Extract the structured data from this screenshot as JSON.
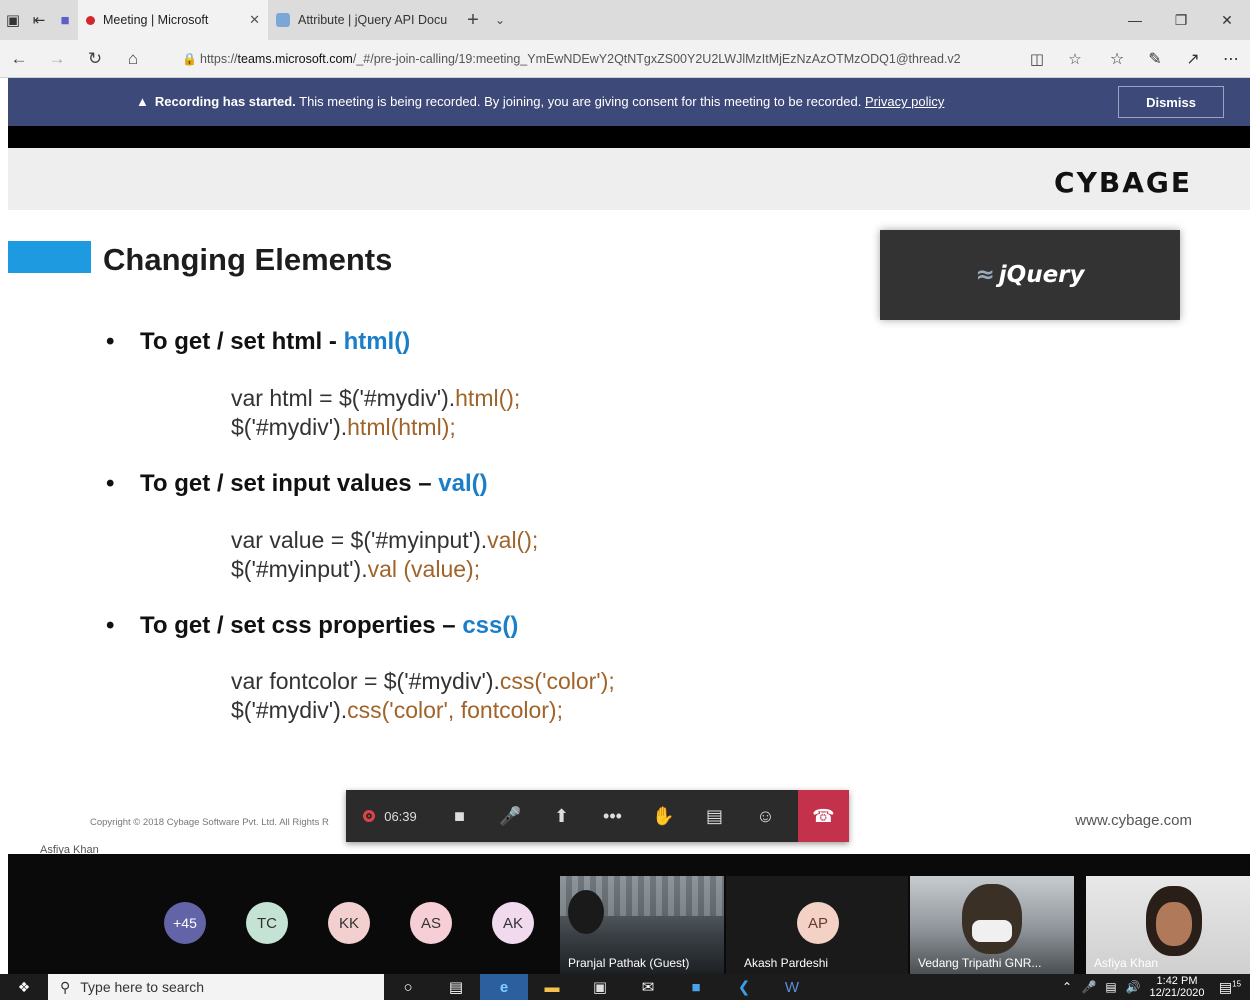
{
  "browser": {
    "tabs": [
      {
        "title": "Meeting | Microsoft",
        "active": true,
        "recording": true
      },
      {
        "title": "Attribute | jQuery API Docu",
        "active": false
      }
    ],
    "url": {
      "scheme": "https://",
      "host": "teams.microsoft.com",
      "path": "/_#/pre-join-calling/19:meeting_YmEwNDEwY2QtNTgxZS00Y2U2LWJlMzItMjEzNzAzOTMzODQ1@thread.v2"
    }
  },
  "banner": {
    "lead": "Recording has started.",
    "text": " This meeting is being recorded. By joining, you are giving consent for this meeting to be recorded. ",
    "link": "Privacy policy",
    "dismiss": "Dismiss"
  },
  "slide": {
    "logo": "CYBAGE",
    "title": "Changing Elements",
    "jquery_logo": "jQuery",
    "bullets": [
      {
        "text": "To get / set html - ",
        "fn": "html()",
        "code": [
          {
            "pre": "var html = $('#mydiv').",
            "method": "html();"
          },
          {
            "pre": "$('#mydiv').",
            "method": "html(html);"
          }
        ]
      },
      {
        "text": "To get / set input values – ",
        "fn": "val()",
        "code": [
          {
            "pre": "var value = $('#myinput').",
            "method": "val();"
          },
          {
            "pre": "$('#myinput').",
            "method": "val (value);"
          }
        ]
      },
      {
        "text": "To get / set css properties – ",
        "fn": "css()",
        "code": [
          {
            "pre": "var fontcolor = $('#mydiv').",
            "method": "css('color');"
          },
          {
            "pre": "$('#mydiv').",
            "method": "css('color', fontcolor);"
          }
        ]
      }
    ],
    "copyright": "Copyright © 2018 Cybage Software Pvt. Ltd. All Rights R",
    "website": "www.cybage.com",
    "presenter": "Asfiya Khan"
  },
  "callbar": {
    "timer": "06:39"
  },
  "participants": {
    "more": "+45",
    "avatars": [
      {
        "initials": "TC",
        "color": "#c5e3d5"
      },
      {
        "initials": "KK",
        "color": "#f2d0d0"
      },
      {
        "initials": "AS",
        "color": "#f6cfd6"
      },
      {
        "initials": "AK",
        "color": "#f1d9ee"
      }
    ],
    "tiles": [
      {
        "name": "Pranjal Pathak (Guest)"
      },
      {
        "name": "Akash Pardeshi",
        "initials": "AP"
      },
      {
        "name": "Vedang Tripathi GNR..."
      },
      {
        "name": "Asfiya Khan"
      }
    ]
  },
  "taskbar": {
    "search_placeholder": "Type here to search",
    "time": "1:42 PM",
    "date": "12/21/2020",
    "notifications": "15"
  }
}
